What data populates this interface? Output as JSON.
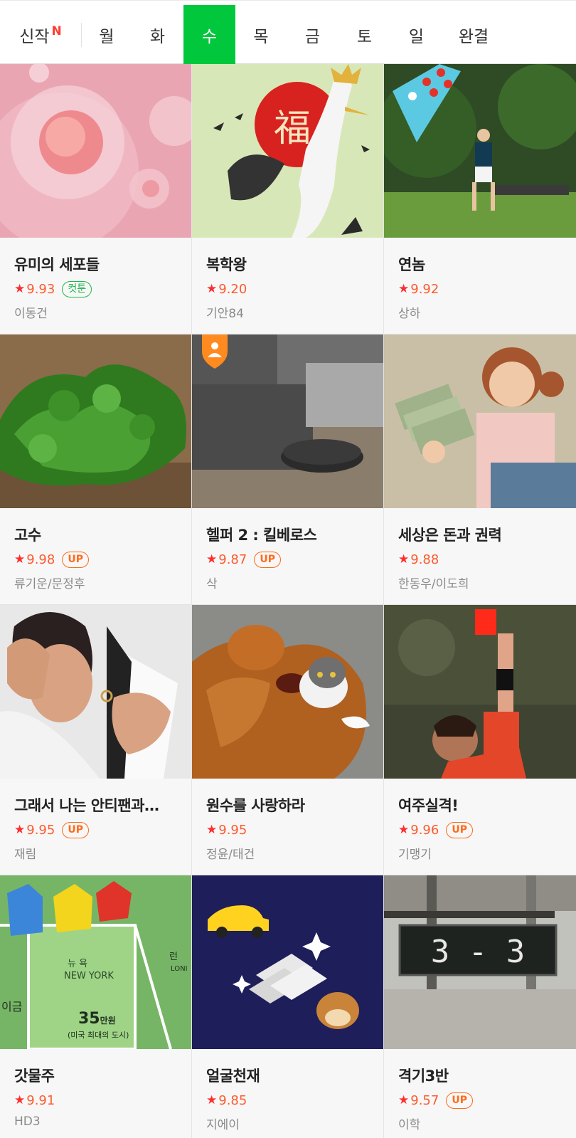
{
  "tabs": {
    "new_label": "신작",
    "new_badge": "N",
    "days": [
      {
        "label": "월",
        "active": false
      },
      {
        "label": "화",
        "active": false
      },
      {
        "label": "수",
        "active": true
      },
      {
        "label": "목",
        "active": false
      },
      {
        "label": "금",
        "active": false
      },
      {
        "label": "토",
        "active": false
      },
      {
        "label": "일",
        "active": false
      },
      {
        "label": "완결",
        "active": false
      }
    ]
  },
  "colors": {
    "accent_green": "#00c73c",
    "rating_red": "#ff2d2d",
    "up_orange": "#ff6b1a",
    "cuttoon_green": "#1fb84b"
  },
  "webtoons": [
    {
      "title": "유미의 세포들",
      "rating": "9.93",
      "badge": "컷툰",
      "badge_type": "cuttoon",
      "author": "이동건",
      "thumb": "cells"
    },
    {
      "title": "복학왕",
      "rating": "9.20",
      "badge": "",
      "badge_type": "",
      "author": "기안84",
      "thumb": "crane"
    },
    {
      "title": "연놈",
      "rating": "9.92",
      "badge": "",
      "badge_type": "",
      "author": "상하",
      "thumb": "kite"
    },
    {
      "title": "고수",
      "rating": "9.98",
      "badge": "UP",
      "badge_type": "up",
      "author": "류기운/문정후",
      "thumb": "cilantro"
    },
    {
      "title": "헬퍼 2 : 킬베로스",
      "rating": "9.87",
      "badge": "UP",
      "badge_type": "up",
      "author": "삭",
      "thumb": "robot"
    },
    {
      "title": "세상은 돈과 권력",
      "rating": "9.88",
      "badge": "",
      "badge_type": "",
      "author": "한동우/이도희",
      "thumb": "money"
    },
    {
      "title": "그래서 나는 안티팬과…",
      "rating": "9.95",
      "badge": "UP",
      "badge_type": "up",
      "author": "재림",
      "thumb": "ring"
    },
    {
      "title": "원수를 사랑하라",
      "rating": "9.95",
      "badge": "",
      "badge_type": "",
      "author": "정윤/태건",
      "thumb": "dogcat"
    },
    {
      "title": "여주실격!",
      "rating": "9.96",
      "badge": "UP",
      "badge_type": "up",
      "author": "기맹기",
      "thumb": "redcard"
    },
    {
      "title": "갓물주",
      "rating": "9.91",
      "badge": "",
      "badge_type": "",
      "author": "HD3",
      "thumb": "board"
    },
    {
      "title": "얼굴천재",
      "rating": "9.85",
      "badge": "",
      "badge_type": "",
      "author": "지에이",
      "thumb": "gold"
    },
    {
      "title": "격기3반",
      "rating": "9.57",
      "badge": "UP",
      "badge_type": "up",
      "author": "이학",
      "thumb": "score"
    }
  ],
  "thumb_text": {
    "board_city_ko": "뉴 욕",
    "board_city_en": "NEW YORK",
    "board_price": "35",
    "board_price_unit": "만원",
    "board_caption": "(미국 최대의 도시)",
    "board_edge_left": "이금",
    "board_edge_right_top": "런",
    "board_edge_right": "LONI",
    "crane_char": "福",
    "score_text": "3 - 3"
  }
}
